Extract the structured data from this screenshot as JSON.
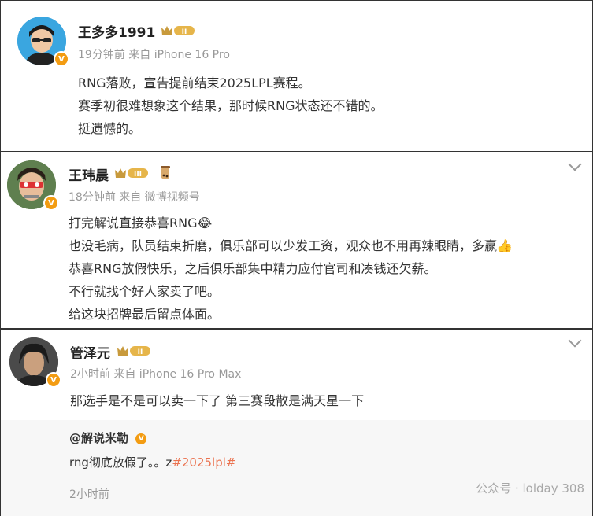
{
  "posts": [
    {
      "author": "王多多1991",
      "level": "II",
      "meta": "19分钟前  来自 iPhone 16 Pro",
      "lines": [
        "RNG落败，宣告提前结束2025LPL赛程。",
        "赛季初很难想象这个结果，那时候RNG状态还不错的。",
        "挺遗憾的。"
      ]
    },
    {
      "author": "王玮晨",
      "level": "III",
      "meta": "18分钟前  来自 微博视频号",
      "lines": [
        "打完解说直接恭喜RNG😂",
        "也没毛病，队员结束折磨，俱乐部可以少发工资，观众也不用再辣眼睛，多赢👍",
        "恭喜RNG放假快乐，之后俱乐部集中精力应付官司和凑钱还欠薪。",
        "不行就找个好人家卖了吧。",
        "给这块招牌最后留点体面。"
      ]
    },
    {
      "author": "管泽元",
      "level": "II",
      "meta": "2小时前  来自 iPhone 16 Pro Max",
      "lines": [
        "那选手是不是可以卖一下了 第三赛段散是满天星一下"
      ],
      "quote": {
        "author": "@解说米勒",
        "text": "rng彻底放假了。。z",
        "hashtag": "#2025lpl#",
        "time": "2小时前"
      }
    }
  ],
  "watermark": "公众号 · lolday 308",
  "colors": {
    "verified": "#f39c12",
    "hashtag": "#eb7350",
    "meta": "#999999"
  }
}
